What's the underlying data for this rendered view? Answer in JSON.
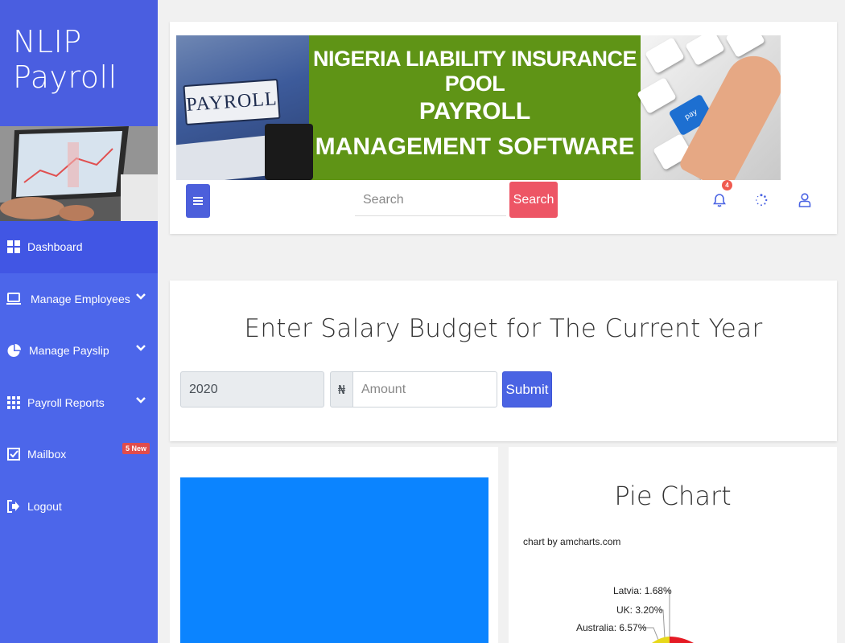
{
  "sidebar": {
    "brand": [
      "NLIP",
      "Payroll"
    ],
    "items": [
      {
        "label": "Dashboard",
        "icon": "grid-icon",
        "active": true
      },
      {
        "label": "Manage Employees",
        "icon": "laptop-icon",
        "chevron": true
      },
      {
        "label": "Manage Payslip",
        "icon": "pie-icon",
        "chevron": true
      },
      {
        "label": "Payroll Reports",
        "icon": "table-icon",
        "chevron": true
      },
      {
        "label": "Mailbox",
        "icon": "check-square-icon",
        "badge": "5 New"
      },
      {
        "label": "Logout",
        "icon": "logout-icon"
      }
    ]
  },
  "banner": {
    "binder_label": "PAYROLL",
    "line1": "NIGERIA LIABILITY INSURANCE POOL",
    "line2": "PAYROLL",
    "line3": "MANAGEMENT SOFTWARE",
    "key_label": "pay"
  },
  "header": {
    "search_placeholder": "Search",
    "search_button": "Search",
    "notification_count": "4"
  },
  "budget": {
    "title": "Enter Salary Budget for The Current Year",
    "year": "2020",
    "currency_symbol": "₦",
    "amount_placeholder": "Amount",
    "submit_label": "Submit"
  },
  "pie_card": {
    "title": "Pie Chart",
    "credit": "chart by amcharts.com",
    "labels": [
      "Latvia: 1.68%",
      "UK: 3.20%",
      "Australia: 6.57%"
    ]
  },
  "colors": {
    "sidebar": "#4c66ea",
    "accent": "#4a63e3",
    "search_button": "#ed5565",
    "banner_green": "#5f9416",
    "blue_panel": "#0b84ff"
  }
}
